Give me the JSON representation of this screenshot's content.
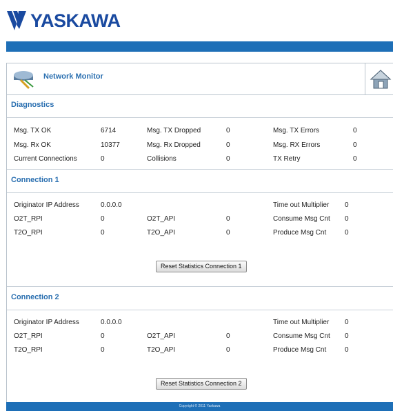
{
  "brand": {
    "name": "YASKAWA",
    "color": "#1a4aa0"
  },
  "accent_color": "#1e6fb7",
  "header": {
    "title": "Network Monitor",
    "icon": "network-device-icon",
    "home_icon": "home-icon"
  },
  "diagnostics": {
    "title": "Diagnostics",
    "rows": [
      [
        {
          "label": "Msg. TX OK",
          "value": "6714"
        },
        {
          "label": "Msg. TX Dropped",
          "value": "0"
        },
        {
          "label": "Msg. TX Errors",
          "value": "0"
        }
      ],
      [
        {
          "label": "Msg. Rx OK",
          "value": "10377"
        },
        {
          "label": "Msg. Rx Dropped",
          "value": "0"
        },
        {
          "label": "Msg. RX Errors",
          "value": "0"
        }
      ],
      [
        {
          "label": "Current Connections",
          "value": "0"
        },
        {
          "label": "Collisions",
          "value": "0"
        },
        {
          "label": "TX Retry",
          "value": "0"
        }
      ]
    ]
  },
  "connections": [
    {
      "title": "Connection 1",
      "rows": [
        [
          {
            "label": "Originator IP Address",
            "value": "0.0.0.0"
          },
          {
            "label": "",
            "value": ""
          },
          {
            "label": "Time out Multiplier",
            "value": "0"
          }
        ],
        [
          {
            "label": "O2T_RPI",
            "value": "0"
          },
          {
            "label": "O2T_API",
            "value": "0"
          },
          {
            "label": "Consume Msg Cnt",
            "value": "0"
          }
        ],
        [
          {
            "label": "T2O_RPI",
            "value": "0"
          },
          {
            "label": "T2O_API",
            "value": "0"
          },
          {
            "label": "Produce Msg Cnt",
            "value": "0"
          }
        ]
      ],
      "button": "Reset Statistics Connection 1"
    },
    {
      "title": "Connection 2",
      "rows": [
        [
          {
            "label": "Originator IP Address",
            "value": "0.0.0.0"
          },
          {
            "label": "",
            "value": ""
          },
          {
            "label": "Time out Multiplier",
            "value": "0"
          }
        ],
        [
          {
            "label": "O2T_RPI",
            "value": "0"
          },
          {
            "label": "O2T_API",
            "value": "0"
          },
          {
            "label": "Consume Msg Cnt",
            "value": "0"
          }
        ],
        [
          {
            "label": "T2O_RPI",
            "value": "0"
          },
          {
            "label": "T2O_API",
            "value": "0"
          },
          {
            "label": "Produce Msg Cnt",
            "value": "0"
          }
        ]
      ],
      "button": "Reset Statistics Connection 2"
    }
  ],
  "footer": {
    "text": "Copyright © 2011 Yaskawa"
  }
}
